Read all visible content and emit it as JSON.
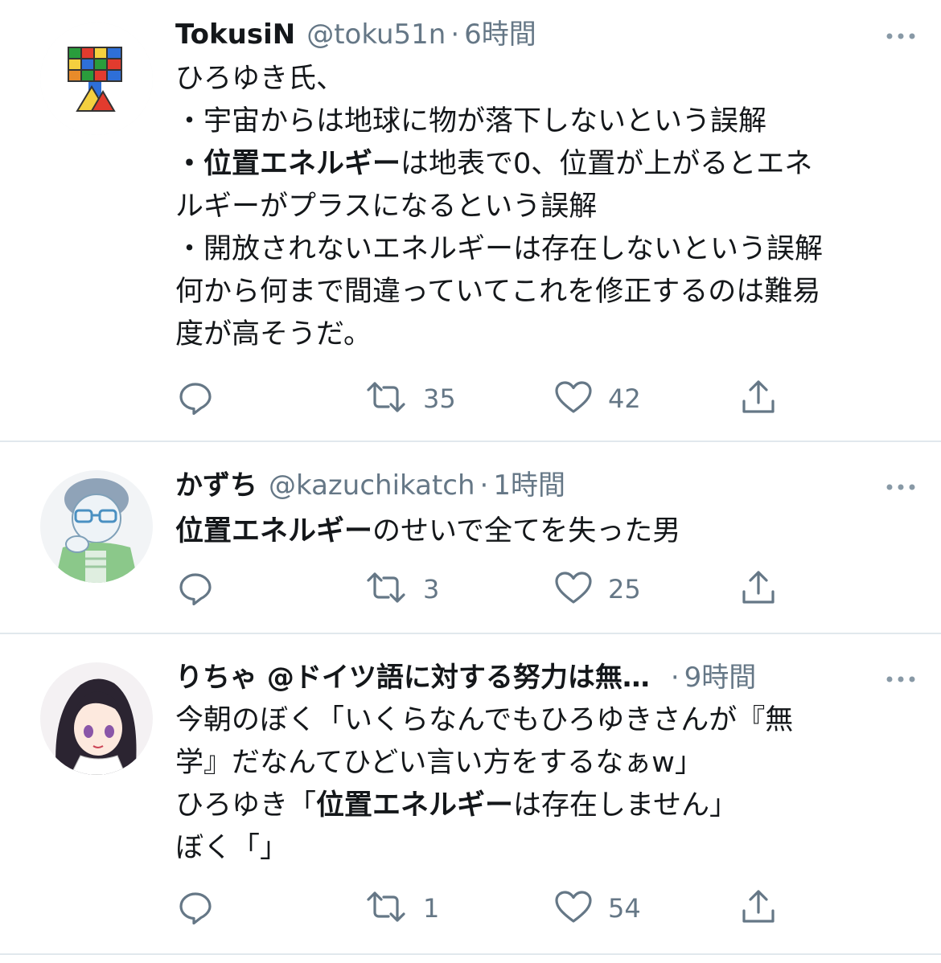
{
  "tweets": [
    {
      "name": "TokusiN",
      "handle": "@toku51n",
      "sep": "·",
      "time": "6時間",
      "lines": [
        [
          {
            "t": "ひろゆき氏、"
          }
        ],
        [
          {
            "t": "・宇宙からは地球に物が落下しないという誤解"
          }
        ],
        [
          {
            "t": "・位置エネルギー",
            "b": true
          },
          {
            "t": "は地表で0、位置が上がるとエネ"
          }
        ],
        [
          {
            "t": "ルギーがプラスになるという誤解"
          }
        ],
        [
          {
            "t": "・開放されないエネルギーは存在しないという誤解"
          }
        ],
        [
          {
            "t": "何から何まで間違っていてこれを修正するのは難易"
          }
        ],
        [
          {
            "t": "度が高そうだ。"
          }
        ]
      ],
      "retweets": "35",
      "likes": "42",
      "replies": ""
    },
    {
      "name": "かずち",
      "handle": "@kazuchikatch",
      "sep": "·",
      "time": "1時間",
      "lines": [
        [
          {
            "t": "位置エネルギー",
            "b": true
          },
          {
            "t": "のせいで全てを失った男"
          }
        ]
      ],
      "retweets": "3",
      "likes": "25",
      "replies": ""
    },
    {
      "name": "りちゃ @ドイツ語に対する努力は無…",
      "handle": "",
      "sep": "·",
      "time": "9時間",
      "lines": [
        [
          {
            "t": "今朝のぼく「いくらなんでもひろゆきさんが『無"
          }
        ],
        [
          {
            "t": "学』だなんてひどい言い方をするなぁw」"
          }
        ],
        [
          {
            "t": "ひろゆき「"
          },
          {
            "t": "位置エネルギー",
            "b": true
          },
          {
            "t": "は存在しません」"
          }
        ],
        [
          {
            "t": "ぼく「」"
          }
        ]
      ],
      "retweets": "1",
      "likes": "54",
      "replies": ""
    }
  ],
  "icons": {
    "more": "more-icon",
    "reply": "reply-icon",
    "retweet": "retweet-icon",
    "like": "heart-icon",
    "share": "share-icon"
  },
  "colors": {
    "text": "#14171a",
    "muted": "#657786",
    "divider": "#e1e8ed"
  }
}
